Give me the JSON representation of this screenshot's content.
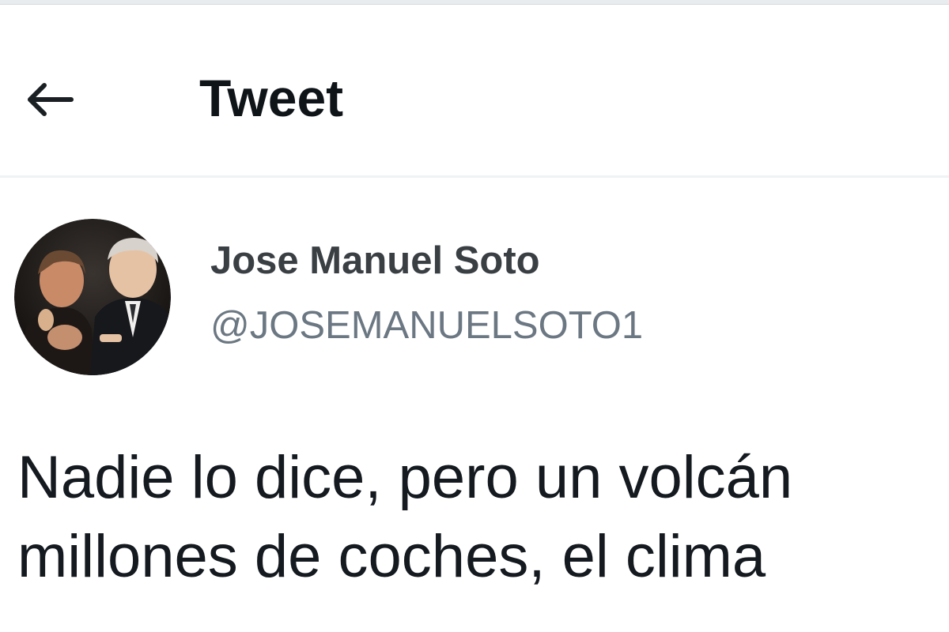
{
  "header": {
    "back_icon": "arrow-left-icon",
    "title": "Tweet"
  },
  "tweet": {
    "author": {
      "display_name": "Jose Manuel Soto",
      "handle": "@JOSEMANUELSOTO1",
      "avatar_icon": "profile-photo"
    },
    "text_lines": [
      "Nadie lo dice, pero un volcán",
      "millones de coches, el clima"
    ]
  },
  "colors": {
    "text_primary": "#0f1419",
    "text_secondary": "#6b7782",
    "divider": "#eff3f4"
  }
}
